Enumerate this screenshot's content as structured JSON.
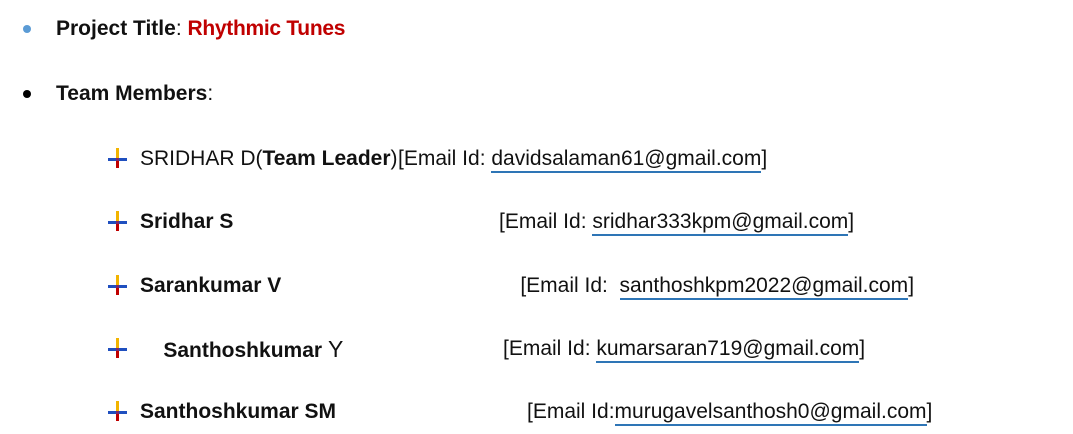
{
  "project": {
    "label": "Project Title",
    "separator": ":",
    "title": "Rhythmic Tunes"
  },
  "team": {
    "label": "Team Members",
    "separator": ":"
  },
  "members": [
    {
      "name_plain": "SRIDHAR D(",
      "name_bold": "Team Leader",
      "name_tail": ")",
      "email_prefix": "[Email Id: ",
      "email": "davidsalaman61@gmail.com",
      "email_suffix": "]"
    },
    {
      "name_bold": "Sridhar S",
      "email_prefix": "[Email Id: ",
      "email": "sridhar333kpm@gmail.com",
      "email_suffix": "]"
    },
    {
      "name_bold": "Sarankumar V",
      "email_prefix": "[Email Id:  ",
      "email": "santhoshkpm2022@gmail.com",
      "email_suffix": "]"
    },
    {
      "name_bold": "Santhoshkumar",
      "name_plain_tail": " Y",
      "email_prefix": "[Email Id: ",
      "email": "kumarsaran719@gmail.com",
      "email_suffix": "]"
    },
    {
      "name_bold": "Santhoshkumar SM",
      "email_prefix": "[Email Id:",
      "email": "murugavelsanthosh0@gmail.com",
      "email_suffix": "]"
    }
  ],
  "colors": {
    "title_red": "#c00000",
    "bullet_blue": "#5b9bd5",
    "link_underline": "#2e75b6"
  },
  "icons": {
    "member_bullet": "pin-arrow-icon"
  }
}
